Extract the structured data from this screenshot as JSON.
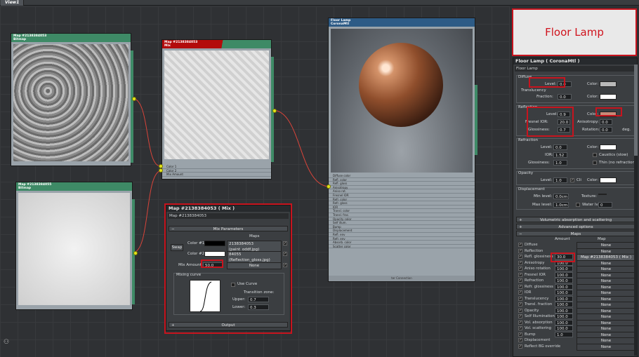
{
  "tab": {
    "label": "View1"
  },
  "bitmap1": {
    "title": "Map #2138384053",
    "type": "Bitmap"
  },
  "bitmap2": {
    "title": "Map #2138384055",
    "type": "Bitmap"
  },
  "mixnode": {
    "title": "Map #2138384053",
    "type": "Mix",
    "slots": [
      "Color 1",
      "Color 2",
      "Mix Amount"
    ]
  },
  "matnode": {
    "title": "Floor Lamp",
    "type": "CoronaMtl",
    "slots": [
      "Diffuse color",
      "Refl. color",
      "Refl. gloss",
      "Anisotropy",
      "Aniso rot.",
      "Fresnel IOR",
      "Refr. color",
      "Refr. gloss",
      "IOR",
      "Transl. color",
      "Transl. frac.",
      "Opacity color",
      "Self illum.",
      "Bump",
      "Displacement",
      "Refl. env",
      "Refr. env",
      "Absorb. color",
      "Scatter color"
    ],
    "footer": "ter Connection"
  },
  "mixpanel": {
    "title": "Map #2138384053  ( Mix )",
    "name": "Map #2138384053",
    "rollout": "Mix Parameters",
    "maps_label": "Maps",
    "swap_label": "Swap",
    "color1_label": "Color #1",
    "color1_map": "2138384053 (paint_oddf.jpg)",
    "color2_label": "Color #2",
    "color2_map": "84055 (Reflection_gloss.jpg)",
    "mix_amount_label": "Mix Amount:",
    "mix_amount": "50.0",
    "mix_map": "None",
    "mixing_curve_label": "Mixing curve",
    "use_curve_label": "Use Curve",
    "transition_label": "Transition zone:",
    "upper_label": "Upper:",
    "upper": "0.7",
    "lower_label": "Lower:",
    "lower": "0.3",
    "output_label": "Output"
  },
  "preview": {
    "title": "Floor Lamp"
  },
  "mtl": {
    "header": "Floor Lamp  ( CoronaMtl )",
    "name": "Floor Lamp",
    "diffuse": {
      "title": "Diffuse",
      "level_label": "Level:",
      "level": "0.0",
      "color_label": "Color:",
      "transl_label": "Translucency",
      "fraction_label": "Fraction:",
      "fraction": "0.0"
    },
    "reflection": {
      "title": "Reflection",
      "level_label": "Level:",
      "level": "0.9",
      "color_label": "Color:",
      "ior_label": "Fresnel IOR:",
      "ior": "20.0",
      "aniso_label": "Anisotropy:",
      "aniso": "0.0",
      "gloss_label": "Glossiness:",
      "gloss": "0.7",
      "rot_label": "Rotation:",
      "rot": "0.0",
      "deg": "deg."
    },
    "refraction": {
      "title": "Refraction",
      "level_label": "Level:",
      "level": "0.0",
      "color_label": "Color:",
      "ior_label": "IOR:",
      "ior": "1.52",
      "caustics_label": "Caustics (slow)",
      "gloss_label": "Glossiness:",
      "gloss": "1.0",
      "thin_label": "Thin (no refraction)"
    },
    "opacity": {
      "title": "Opacity",
      "level_label": "Level:",
      "level": "1.0",
      "clip_label": "Cli",
      "color_label": "Color:"
    },
    "displacement": {
      "title": "Displacement",
      "min_label": "Min level:",
      "min": "0.0cm",
      "texture_label": "Texture:",
      "max_label": "Max level:",
      "max": "1.0cm",
      "water_label": "Water lvl.",
      "water": "0"
    },
    "rollouts": [
      "Volumetric absorption and scattering",
      "Advanced options",
      "Maps"
    ],
    "maps_amount_header": "Amount",
    "maps_map_header": "Map",
    "maps": [
      {
        "name": "Diffuse",
        "amount": "",
        "map": "None"
      },
      {
        "name": "Reflection",
        "amount": "",
        "map": "None"
      },
      {
        "name": "Refl. glossiness",
        "amount": "30.0",
        "map": "Map #2138384053  ( Mix )"
      },
      {
        "name": "Anisotropy",
        "amount": "100.0",
        "map": "None"
      },
      {
        "name": "Aniso rotation",
        "amount": "100.0",
        "map": "None"
      },
      {
        "name": "Fresnel IOR",
        "amount": "100.0",
        "map": "None"
      },
      {
        "name": "Refraction",
        "amount": "100.0",
        "map": "None"
      },
      {
        "name": "Refr. glossiness",
        "amount": "100.0",
        "map": "None"
      },
      {
        "name": "IOR",
        "amount": "100.0",
        "map": "None"
      },
      {
        "name": "Translucency",
        "amount": "100.0",
        "map": "None"
      },
      {
        "name": "Transl. fraction",
        "amount": "100.0",
        "map": "None"
      },
      {
        "name": "Opacity",
        "amount": "100.0",
        "map": "None"
      },
      {
        "name": "Self Illumination",
        "amount": "100.0",
        "map": "None"
      },
      {
        "name": "Vol. absorption",
        "amount": "100.0",
        "map": "None"
      },
      {
        "name": "Vol. scattering",
        "amount": "100.0",
        "map": "None"
      },
      {
        "name": "Bump",
        "amount": "1.0",
        "map": "None"
      },
      {
        "name": "Displacement",
        "amount": "",
        "map": "None"
      },
      {
        "name": "Reflect BG override",
        "amount": "",
        "map": "None"
      }
    ]
  },
  "colors": {
    "node_green": "#3e8a66",
    "highlight": "#c8141e",
    "refl_color": "#c98a78",
    "wire": "#d9443a"
  }
}
